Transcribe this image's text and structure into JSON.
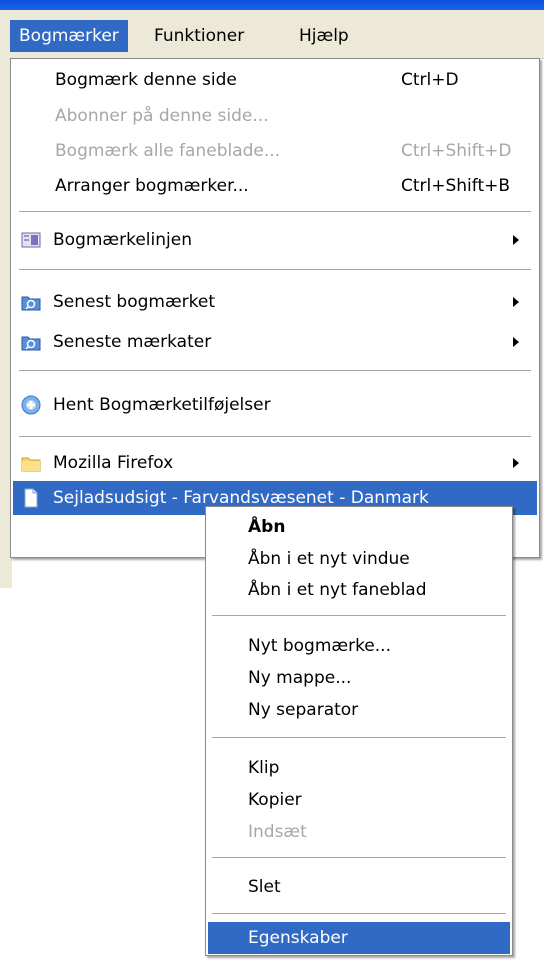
{
  "menubar": {
    "items": [
      {
        "label": "Bogmærker",
        "active": true
      },
      {
        "label": "Funktioner",
        "active": false
      },
      {
        "label": "Hjælp",
        "active": false
      }
    ]
  },
  "bookmarks_menu": {
    "bookmark_page": {
      "label": "Bogmærk denne side",
      "shortcut": "Ctrl+D"
    },
    "subscribe": {
      "label": "Abonner på denne side..."
    },
    "bookmark_all_tabs": {
      "label": "Bogmærk alle faneblade...",
      "shortcut": "Ctrl+Shift+D"
    },
    "organize": {
      "label": "Arranger bogmærker...",
      "shortcut": "Ctrl+Shift+B"
    },
    "toolbar": {
      "label": "Bogmærkelinjen"
    },
    "recently_bookmarked": {
      "label": "Senest bogmærket"
    },
    "recent_tags": {
      "label": "Seneste mærkater"
    },
    "get_addons": {
      "label": "Hent Bogmærketilføjelser"
    },
    "mozilla_firefox": {
      "label": "Mozilla Firefox"
    },
    "sejladsudsigt": {
      "label": "Sejladsudsigt - Farvandsvæsenet - Danmark"
    }
  },
  "context_menu": {
    "open": "Åbn",
    "open_new_window": "Åbn i et nyt vindue",
    "open_new_tab": "Åbn i et nyt faneblad",
    "new_bookmark": "Nyt bogmærke...",
    "new_folder": "Ny mappe...",
    "new_separator": "Ny separator",
    "cut": "Klip",
    "copy": "Kopier",
    "paste": "Indsæt",
    "delete": "Slet",
    "properties": "Egenskaber"
  },
  "colors": {
    "highlight": "#316ac5",
    "menubar_bg": "#ece9d8",
    "disabled_text": "#a7a6aa"
  }
}
